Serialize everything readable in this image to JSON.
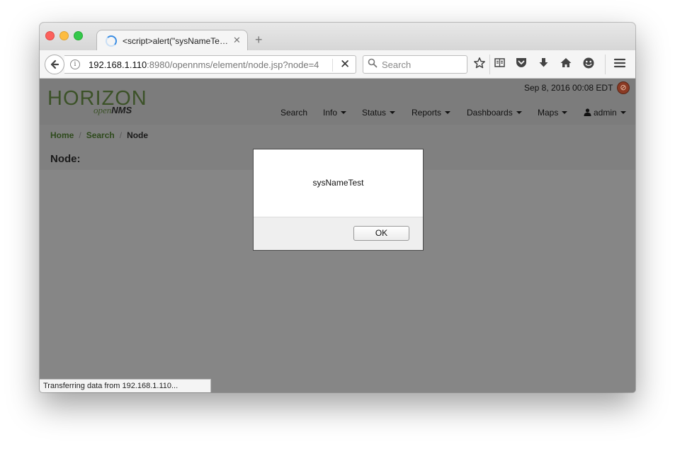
{
  "browser": {
    "tab": {
      "title": "<script>alert(\"sysNameTes..."
    },
    "url": {
      "host": "192.168.1.110",
      "rest": ":8980/opennms/element/node.jsp?node=4"
    },
    "search_placeholder": "Search",
    "status_text": "Transferring data from 192.168.1.110..."
  },
  "app": {
    "logo": {
      "main": "HORIZON",
      "open": "open",
      "nms": "NMS"
    },
    "timestamp": "Sep 8, 2016 00:08 EDT",
    "nav": {
      "search": "Search",
      "info": "Info",
      "status": "Status",
      "reports": "Reports",
      "dashboards": "Dashboards",
      "maps": "Maps",
      "user": "admin"
    },
    "breadcrumb": {
      "home": "Home",
      "search": "Search",
      "current": "Node"
    },
    "page_title": "Node:"
  },
  "dialog": {
    "message": "sysNameTest",
    "ok_label": "OK"
  },
  "colors": {
    "accent": "#3c5228",
    "header_bg": "#7c7c7c"
  }
}
